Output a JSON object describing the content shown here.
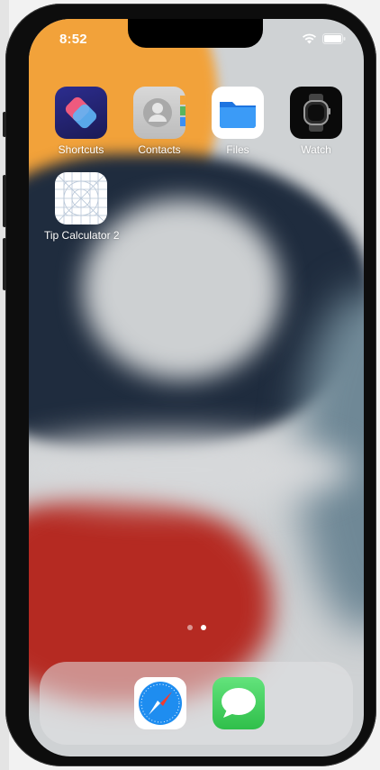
{
  "status_bar": {
    "time": "8:52"
  },
  "home_screen": {
    "apps": [
      {
        "label": "Shortcuts",
        "icon": "shortcuts-icon"
      },
      {
        "label": "Contacts",
        "icon": "contacts-icon"
      },
      {
        "label": "Files",
        "icon": "files-folder-icon"
      },
      {
        "label": "Watch",
        "icon": "watch-icon"
      },
      {
        "label": "Tip Calculator 2",
        "icon": "tip-calculator-placeholder-icon"
      }
    ],
    "page_indicator": {
      "pages": 2,
      "current_page": 2
    }
  },
  "dock": {
    "apps": [
      {
        "name": "Safari",
        "icon": "safari-compass-icon"
      },
      {
        "name": "Messages",
        "icon": "messages-bubble-icon"
      }
    ]
  },
  "colors": {
    "shortcuts_bg": "#2b1d7a",
    "files_blue": "#3b8ff5",
    "messages_green": "#4cd964",
    "safari_blue": "#1e8df0",
    "wallpaper_orange": "#f2a23a",
    "wallpaper_navy": "#1f2c3e",
    "wallpaper_red": "#b52a22"
  }
}
